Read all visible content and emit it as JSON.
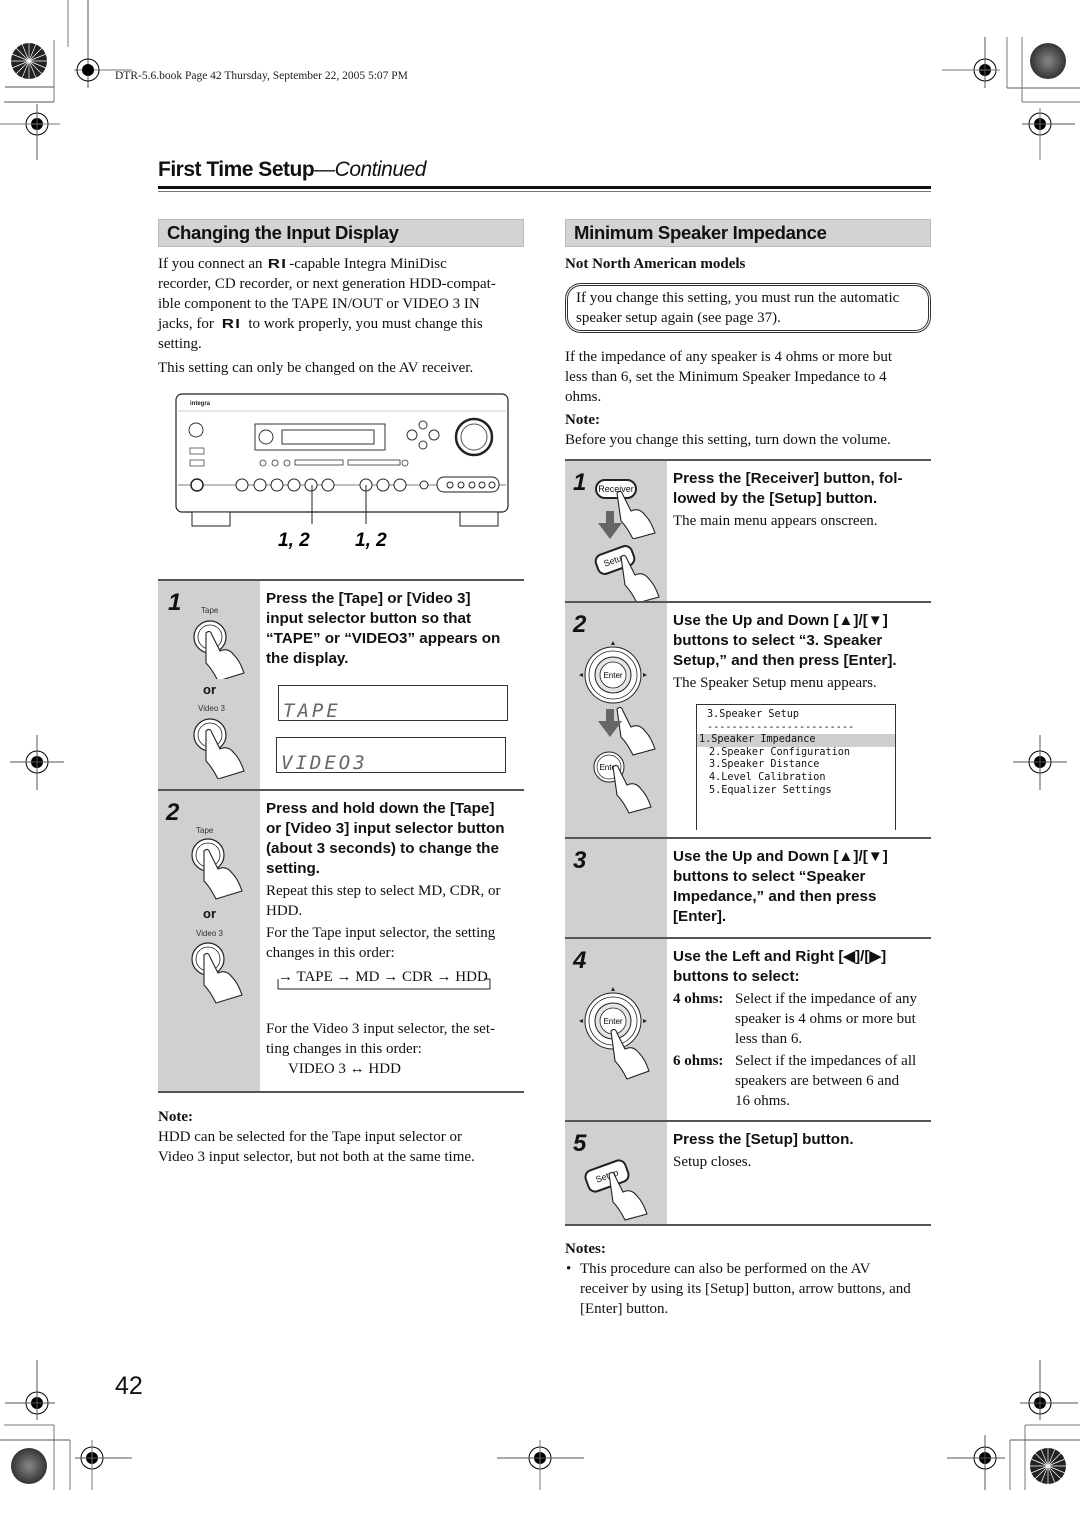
{
  "print_header": "DTR-5.6.book  Page 42  Thursday, September 22, 2005  5:07 PM",
  "page": {
    "title": "First Time Setup",
    "title_suffix": "—Continued",
    "number": "42"
  },
  "left": {
    "heading": "Changing the Input Display",
    "intro_1a": "If you connect an",
    "ri_logo": "RI",
    "intro_1b": "-capable Integra MiniDisc",
    "intro_2": "recorder, CD recorder, or next generation HDD-compat-",
    "intro_3": "ible component to the TAPE IN/OUT or VIDEO 3 IN",
    "intro_4a": "jacks, for",
    "intro_4b": "to work properly, you must change this",
    "intro_5": "setting.",
    "intro_6": "This setting can only be changed on the AV receiver.",
    "receiver": {
      "brand": "integra",
      "callout_left": "1, 2",
      "callout_right": "1, 2"
    },
    "steps": [
      {
        "number": "1",
        "button_top": "Tape",
        "or": "or",
        "button_bottom": "Video 3",
        "heading": [
          "Press the [Tape] or [Video 3]",
          "input selector button so that",
          "“TAPE” or “VIDEO3” appears on",
          "the display."
        ],
        "lcd_1": "TAPE",
        "lcd_2": "VIDEO3"
      },
      {
        "number": "2",
        "button_top": "Tape",
        "or": "or",
        "button_bottom": "Video 3",
        "heading": [
          "Press and hold down the [Tape]",
          "or [Video 3] input selector button",
          "(about 3 seconds) to change the",
          "setting."
        ],
        "text_1": "Repeat this step to select MD, CDR, or",
        "text_2": "HDD.",
        "text_3": "For the Tape input selector, the setting",
        "text_4": "changes in this order:",
        "sequence": "→ TAPE → MD → CDR → HDD",
        "text_5": "For the Video 3 input selector, the set-",
        "text_6": "ting changes in this order:",
        "sequence_2": "VIDEO 3 ↔ HDD"
      }
    ],
    "note_label": "Note:",
    "note_1": "HDD can be selected for the Tape input selector or",
    "note_2": "Video 3 input selector, but not both at the same time."
  },
  "right": {
    "heading": "Minimum Speaker Impedance",
    "subheading": "Not North American models",
    "warning_1": "If you change this setting, you must run the automatic",
    "warning_2": "speaker setup again (see page 37).",
    "para_1": "If the impedance of any speaker is 4 ohms or more but",
    "para_2": "less than 6, set the Minimum Speaker Impedance to 4",
    "para_3": "ohms.",
    "note_label": "Note:",
    "note_text": "Before you change this setting, turn down the volume.",
    "steps": [
      {
        "number": "1",
        "btn_a": "Receiver",
        "btn_b": "Setup",
        "heading": [
          "Press the [Receiver] button, fol-",
          "lowed by the [Setup] button."
        ],
        "text": "The main menu appears onscreen."
      },
      {
        "number": "2",
        "btn": "Enter",
        "heading": [
          "Use the Up and Down [▲]/[▼]",
          "buttons to select “3. Speaker",
          "Setup,” and then press [Enter]."
        ],
        "text": "The Speaker Setup menu appears.",
        "menu": {
          "title": "3.Speaker Setup",
          "divider": "------------------------",
          "items": [
            "1.Speaker Impedance",
            "2.Speaker Configuration",
            "3.Speaker Distance",
            "4.Level Calibration",
            "5.Equalizer Settings"
          ],
          "selected_index": 0
        }
      },
      {
        "number": "3",
        "heading": [
          "Use the Up and Down [▲]/[▼]",
          "buttons to select “Speaker",
          "Impedance,” and then press",
          "[Enter]."
        ]
      },
      {
        "number": "4",
        "btn": "Enter",
        "heading": [
          "Use the Left and Right [◀]/[▶]",
          "buttons to select:"
        ],
        "options": [
          {
            "label": "4 ohms:",
            "lines": [
              "Select if the impedance of any",
              "speaker is 4 ohms or more but",
              "less than 6."
            ]
          },
          {
            "label": "6 ohms:",
            "lines": [
              "Select if the impedances of all",
              "speakers are between 6 and",
              "16 ohms."
            ]
          }
        ]
      },
      {
        "number": "5",
        "btn": "Setup",
        "heading": [
          "Press the [Setup] button."
        ],
        "text": "Setup closes."
      }
    ],
    "notes_label": "Notes:",
    "notes": [
      [
        "This procedure can also be performed on the AV",
        "receiver by using its [Setup] button, arrow buttons, and",
        "[Enter] button."
      ]
    ]
  }
}
